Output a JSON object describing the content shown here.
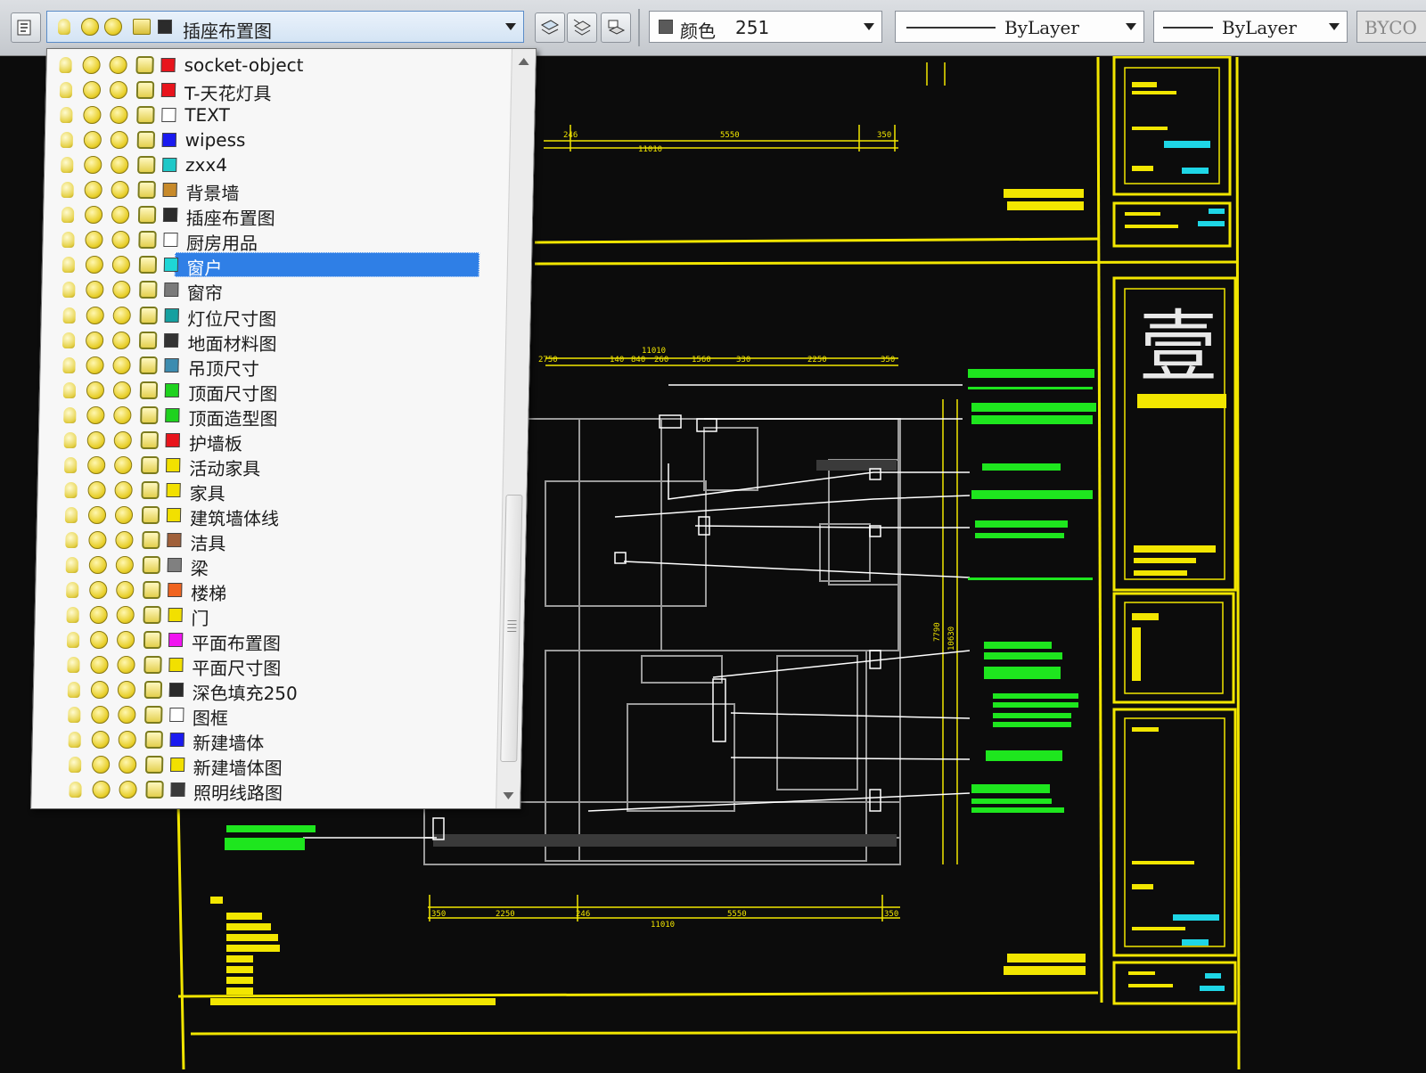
{
  "toolbar": {
    "current_layer": "插座布置图",
    "current_layer_swatch": "#2b2b2b",
    "color_label": "颜色",
    "color_value": "251",
    "color_swatch": "#5a5a5a",
    "linetype_value": "ByLayer",
    "lineweight_value": "ByLayer",
    "plotstyle_value": "BYCO",
    "icons": [
      "layer-properties-icon",
      "make-current-icon",
      "layer-previous-icon",
      "layer-state-icon"
    ]
  },
  "layers": [
    {
      "name": "socket-object",
      "color": "#e8141c"
    },
    {
      "name": "T-天花灯具",
      "color": "#e8141c"
    },
    {
      "name": "TEXT",
      "color": "#ffffff"
    },
    {
      "name": "wipess",
      "color": "#1a1af0"
    },
    {
      "name": "zxx4",
      "color": "#1ec8c8"
    },
    {
      "name": "背景墙",
      "color": "#c88a2a"
    },
    {
      "name": "插座布置图",
      "color": "#2b2b2b"
    },
    {
      "name": "厨房用品",
      "color": "#ffffff"
    },
    {
      "name": "窗户",
      "color": "#1ed6d6",
      "selected": true
    },
    {
      "name": "窗帘",
      "color": "#7a7a7a"
    },
    {
      "name": "灯位尺寸图",
      "color": "#14a0a0"
    },
    {
      "name": "地面材料图",
      "color": "#333333"
    },
    {
      "name": "吊顶尺寸",
      "color": "#3c8cb0"
    },
    {
      "name": "顶面尺寸图",
      "color": "#1ed21e"
    },
    {
      "name": "顶面造型图",
      "color": "#1ed21e"
    },
    {
      "name": "护墙板",
      "color": "#e8141c"
    },
    {
      "name": "活动家具",
      "color": "#f2e000"
    },
    {
      "name": "家具",
      "color": "#f2e000"
    },
    {
      "name": "建筑墙体线",
      "color": "#f2e000"
    },
    {
      "name": "洁具",
      "color": "#a0603a"
    },
    {
      "name": "梁",
      "color": "#808080"
    },
    {
      "name": "楼梯",
      "color": "#f06420"
    },
    {
      "name": "门",
      "color": "#f2e000"
    },
    {
      "name": "平面布置图",
      "color": "#f014f0"
    },
    {
      "name": "平面尺寸图",
      "color": "#f2e000"
    },
    {
      "name": "深色填充250",
      "color": "#2a2a2a"
    },
    {
      "name": "图框",
      "color": "#ffffff"
    },
    {
      "name": "新建墙体",
      "color": "#1a1af0"
    },
    {
      "name": "新建墙体图",
      "color": "#f2e000"
    },
    {
      "name": "照明线路图",
      "color": "#3a3a3a"
    }
  ],
  "drawing": {
    "dims_top": [
      "246",
      "5550",
      "350",
      "11010"
    ],
    "dims_plan": [
      "11010",
      "2750",
      "140",
      "840",
      "260",
      "1560",
      "330",
      "2250",
      "350"
    ],
    "dims_bottom": [
      "350",
      "2250",
      "246",
      "5550",
      "350",
      "11010"
    ],
    "dims_vertical": [
      "7790",
      "10630"
    ],
    "logo_glyph": "壹",
    "colors": {
      "frame": "#f2e600",
      "annotation": "#1ee61e",
      "plan": "#9a9a9a",
      "leader": "#ffffff",
      "cyan": "#1ed6e6"
    }
  }
}
